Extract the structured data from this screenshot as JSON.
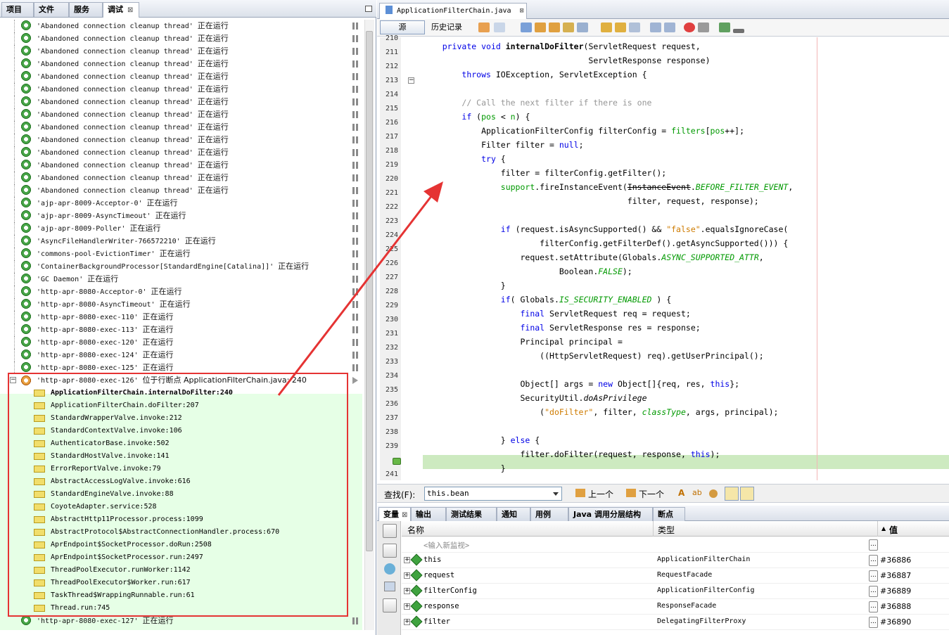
{
  "left_panel": {
    "tabs": [
      "项目",
      "文件",
      "服务",
      "调试"
    ],
    "active_tab": "调试",
    "threads": [
      {
        "name": "'Abandoned connection cleanup thread'",
        "status": "正在运行"
      },
      {
        "name": "'Abandoned connection cleanup thread'",
        "status": "正在运行"
      },
      {
        "name": "'Abandoned connection cleanup thread'",
        "status": "正在运行"
      },
      {
        "name": "'Abandoned connection cleanup thread'",
        "status": "正在运行"
      },
      {
        "name": "'Abandoned connection cleanup thread'",
        "status": "正在运行"
      },
      {
        "name": "'Abandoned connection cleanup thread'",
        "status": "正在运行"
      },
      {
        "name": "'Abandoned connection cleanup thread'",
        "status": "正在运行"
      },
      {
        "name": "'Abandoned connection cleanup thread'",
        "status": "正在运行"
      },
      {
        "name": "'Abandoned connection cleanup thread'",
        "status": "正在运行"
      },
      {
        "name": "'Abandoned connection cleanup thread'",
        "status": "正在运行"
      },
      {
        "name": "'Abandoned connection cleanup thread'",
        "status": "正在运行"
      },
      {
        "name": "'Abandoned connection cleanup thread'",
        "status": "正在运行"
      },
      {
        "name": "'Abandoned connection cleanup thread'",
        "status": "正在运行"
      },
      {
        "name": "'Abandoned connection cleanup thread'",
        "status": "正在运行"
      },
      {
        "name": "'ajp-apr-8009-Acceptor-0'",
        "status": "正在运行"
      },
      {
        "name": "'ajp-apr-8009-AsyncTimeout'",
        "status": "正在运行"
      },
      {
        "name": "'ajp-apr-8009-Poller'",
        "status": "正在运行"
      },
      {
        "name": "'AsyncFileHandlerWriter-766572210'",
        "status": "正在运行"
      },
      {
        "name": "'commons-pool-EvictionTimer'",
        "status": "正在运行"
      },
      {
        "name": "'ContainerBackgroundProcessor[StandardEngine[Catalina]]'",
        "status": "正在运行"
      },
      {
        "name": "'GC Daemon'",
        "status": "正在运行"
      },
      {
        "name": "'http-apr-8080-Acceptor-0'",
        "status": "正在运行"
      },
      {
        "name": "'http-apr-8080-AsyncTimeout'",
        "status": "正在运行"
      },
      {
        "name": "'http-apr-8080-exec-110'",
        "status": "正在运行"
      },
      {
        "name": "'http-apr-8080-exec-113'",
        "status": "正在运行"
      },
      {
        "name": "'http-apr-8080-exec-120'",
        "status": "正在运行"
      },
      {
        "name": "'http-apr-8080-exec-124'",
        "status": "正在运行"
      },
      {
        "name": "'http-apr-8080-exec-125'",
        "status": "正在运行"
      }
    ],
    "suspended_thread": {
      "name": "'http-apr-8080-exec-126'",
      "status": "位于行断点 ApplicationFilterChain.java: 240"
    },
    "frames": [
      "ApplicationFilterChain.internalDoFilter:240",
      "ApplicationFilterChain.doFilter:207",
      "StandardWrapperValve.invoke:212",
      "StandardContextValve.invoke:106",
      "AuthenticatorBase.invoke:502",
      "StandardHostValve.invoke:141",
      "ErrorReportValve.invoke:79",
      "AbstractAccessLogValve.invoke:616",
      "StandardEngineValve.invoke:88",
      "CoyoteAdapter.service:528",
      "AbstractHttp11Processor.process:1099",
      "AbstractProtocol$AbstractConnectionHandler.process:670",
      "AprEndpoint$SocketProcessor.doRun:2508",
      "AprEndpoint$SocketProcessor.run:2497",
      "ThreadPoolExecutor.runWorker:1142",
      "ThreadPoolExecutor$Worker.run:617",
      "TaskThread$WrappingRunnable.run:61",
      "Thread.run:745"
    ],
    "last_thread": {
      "name": "'http-apr-8080-exec-127'",
      "status": "正在运行"
    }
  },
  "editor": {
    "tab_title": "ApplicationFilterChain.java",
    "toolbar": {
      "source": "源",
      "history": "历史记录"
    },
    "line_numbers": [
      "210",
      "211",
      "212",
      "213",
      "214",
      "215",
      "216",
      "217",
      "218",
      "219",
      "220",
      "221",
      "222",
      "223",
      "224",
      "225",
      "226",
      "227",
      "228",
      "229",
      "230",
      "231",
      "232",
      "233",
      "234",
      "235",
      "236",
      "237",
      "238",
      "239",
      "",
      "241"
    ],
    "colors": {
      "current_line": "#cdeac0",
      "keyword": "#0000e6",
      "comment": "#969696",
      "string": "#ce7b00",
      "field": "#009900"
    }
  },
  "find_bar": {
    "label": "查找(F):",
    "value": "this.bean",
    "prev": "上一个",
    "next": "下一个"
  },
  "bottom_panel": {
    "tabs": [
      "变量",
      "输出",
      "测试结果",
      "通知",
      "用例",
      "Java 调用分层结构",
      "断点"
    ],
    "active_tab": "变量",
    "columns": {
      "name": "名称",
      "type": "类型",
      "value": "值"
    },
    "watch_placeholder": "<输入新监视>",
    "variables": [
      {
        "name": "this",
        "type": "ApplicationFilterChain",
        "value": "#36886"
      },
      {
        "name": "request",
        "type": "RequestFacade",
        "value": "#36887"
      },
      {
        "name": "filterConfig",
        "type": "ApplicationFilterConfig",
        "value": "#36889"
      },
      {
        "name": "response",
        "type": "ResponseFacade",
        "value": "#36888"
      },
      {
        "name": "filter",
        "type": "DelegatingFilterProxy",
        "value": "#36890"
      }
    ]
  },
  "annotation_color": "#e53333"
}
